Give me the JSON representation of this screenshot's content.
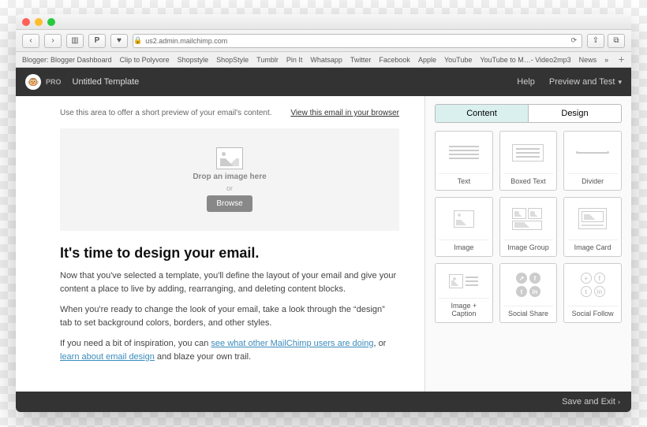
{
  "browser": {
    "url_host": "us2.admin.mailchimp.com",
    "bookmarks": [
      "Blogger: Blogger Dashboard",
      "Clip to Polyvore",
      "Shopstyle",
      "ShopStyle",
      "Tumblr",
      "Pin It",
      "Whatsapp",
      "Twitter",
      "Facebook",
      "Apple",
      "YouTube",
      "YouTube to M…- Video2mp3",
      "News"
    ]
  },
  "header": {
    "pro": "PRO",
    "title": "Untitled Template",
    "help": "Help",
    "preview": "Preview and Test"
  },
  "preview_row": {
    "hint": "Use this area to offer a short preview of your email's content.",
    "view_link": "View this email in your browser"
  },
  "image_drop": {
    "label": "Drop an image here",
    "or": "or",
    "browse": "Browse"
  },
  "article": {
    "heading": "It's time to design your email.",
    "p1": "Now that you've selected a template, you'll define the layout of your email and give your content a place to live by adding, rearranging, and deleting content blocks.",
    "p2": "When you're ready to change the look of your email, take a look through the “design” tab to set background colors, borders, and other styles.",
    "p3_pre": "If you need a bit of inspiration, you can ",
    "p3_link1": "see what other MailChimp users are doing",
    "p3_mid": ", or ",
    "p3_link2": "learn about email design",
    "p3_post": " and blaze your own trail."
  },
  "sidebar": {
    "tabs": {
      "content": "Content",
      "design": "Design"
    },
    "tiles": [
      "Text",
      "Boxed Text",
      "Divider",
      "Image",
      "Image Group",
      "Image Card",
      "Image + Caption",
      "Social Share",
      "Social Follow"
    ]
  },
  "footer": {
    "save": "Save and Exit"
  }
}
